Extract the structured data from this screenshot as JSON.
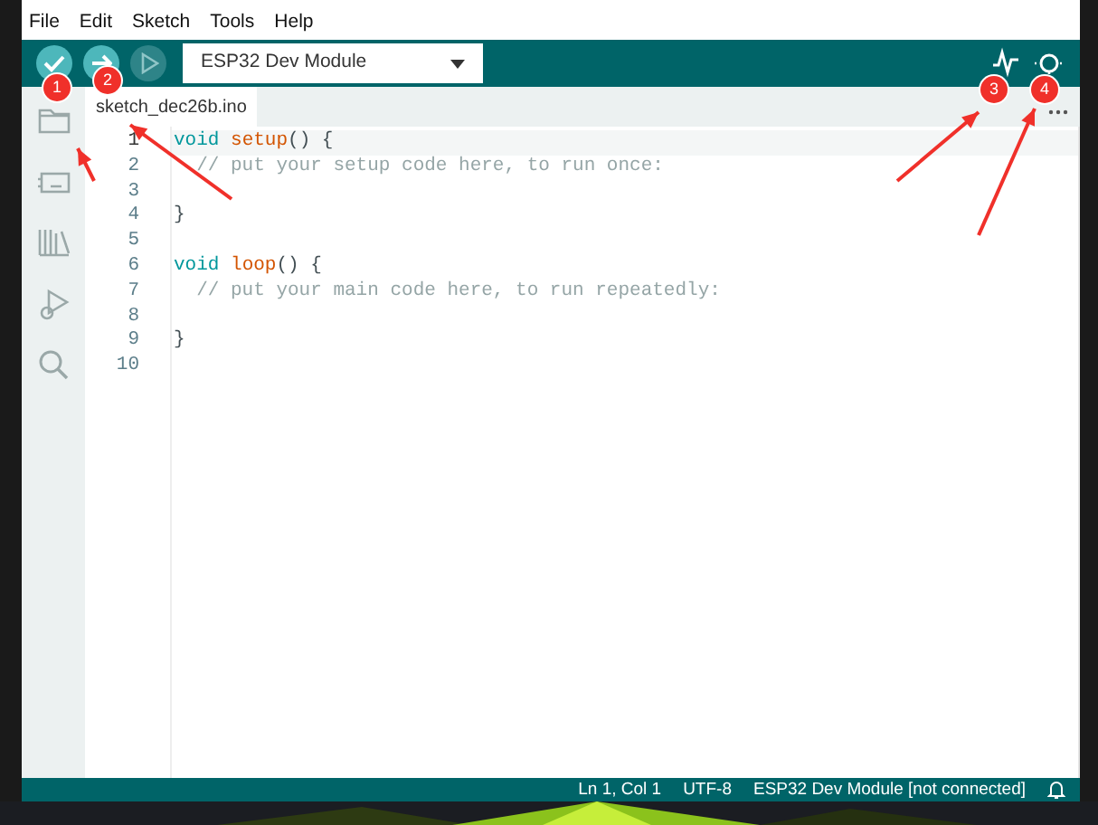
{
  "menu": [
    {
      "label": "File"
    },
    {
      "label": "Edit"
    },
    {
      "label": "Sketch"
    },
    {
      "label": "Tools"
    },
    {
      "label": "Help"
    }
  ],
  "toolbar": {
    "buttons": [
      {
        "kind": "verify",
        "disabled": false
      },
      {
        "kind": "upload",
        "disabled": false
      },
      {
        "kind": "debug",
        "disabled": true
      }
    ],
    "board": "ESP32 Dev Module",
    "right": [
      {
        "kind": "plotter"
      },
      {
        "kind": "monitor"
      }
    ]
  },
  "tabs": [
    {
      "label": "sketch_dec26b.ino",
      "selected": true
    }
  ],
  "sidebar": [
    {
      "kind": "folder"
    },
    {
      "kind": "board"
    },
    {
      "kind": "library"
    },
    {
      "kind": "debug"
    },
    {
      "kind": "search"
    }
  ],
  "code": [
    {
      "number": "1",
      "current": true,
      "indented": false,
      "tokens": [
        {
          "kind": "keyword",
          "text": "void"
        },
        {
          "kind": "function",
          "text": "setup"
        },
        {
          "kind": "plain",
          "text": "() {"
        }
      ]
    },
    {
      "number": "2",
      "current": false,
      "indented": true,
      "tokens": [
        {
          "kind": "comment",
          "text": "// put your setup code here, to run once:"
        }
      ]
    },
    {
      "number": "3",
      "current": false
    },
    {
      "number": "4",
      "current": false,
      "indented": false,
      "tokens": [
        {
          "kind": "plain",
          "text": "}"
        }
      ]
    },
    {
      "number": "5",
      "current": false
    },
    {
      "number": "6",
      "current": false,
      "indented": false,
      "tokens": [
        {
          "kind": "keyword",
          "text": "void"
        },
        {
          "kind": "function",
          "text": "loop"
        },
        {
          "kind": "plain",
          "text": "() {"
        }
      ]
    },
    {
      "number": "7",
      "current": false,
      "indented": true,
      "tokens": [
        {
          "kind": "comment",
          "text": "// put your main code here, to run repeatedly:"
        }
      ]
    },
    {
      "number": "8",
      "current": false
    },
    {
      "number": "9",
      "current": false,
      "indented": false,
      "tokens": [
        {
          "kind": "plain",
          "text": "}"
        }
      ]
    },
    {
      "number": "10",
      "current": false
    }
  ],
  "status_bar": [
    "Ln 1, Col 1",
    "UTF-8",
    "ESP32 Dev Module [not connected]"
  ],
  "annotations": [
    {
      "label": "1"
    },
    {
      "label": "2"
    },
    {
      "label": "3"
    },
    {
      "label": "4"
    }
  ]
}
